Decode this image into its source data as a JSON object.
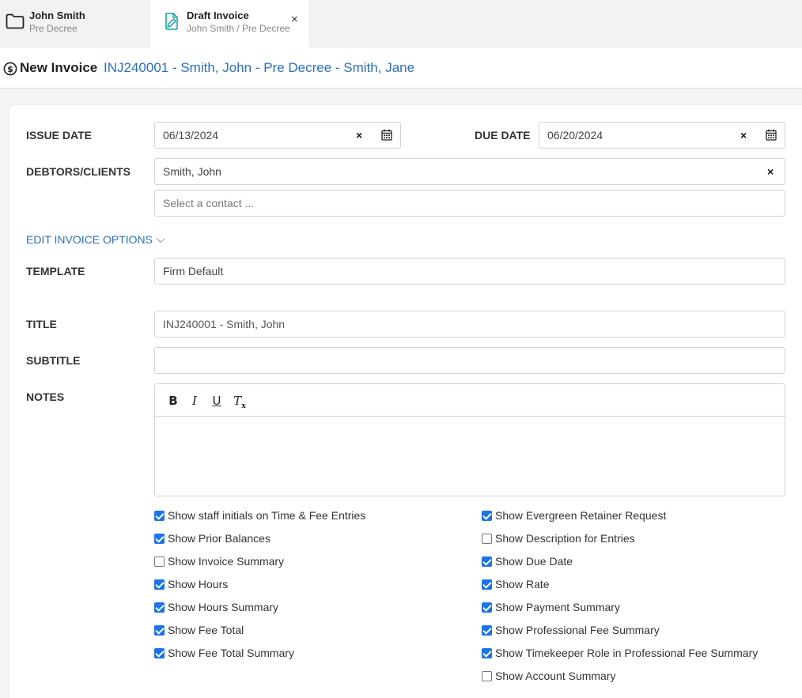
{
  "tabs": [
    {
      "title": "John Smith",
      "subtitle": "Pre Decree"
    },
    {
      "title": "Draft Invoice",
      "subtitle": "John Smith / Pre Decree",
      "close": "×"
    }
  ],
  "header": {
    "title": "New Invoice",
    "reference": "INJ240001 - Smith, John - Pre Decree - Smith, Jane"
  },
  "form": {
    "issue_date_label": "ISSUE DATE",
    "issue_date_value": "06/13/2024",
    "due_date_label": "DUE DATE",
    "due_date_value": "06/20/2024",
    "debtors_label": "DEBTORS/CLIENTS",
    "debtor_value": "Smith, John",
    "contact_placeholder": "Select a contact ...",
    "edit_options_label": "EDIT INVOICE OPTIONS",
    "template_label": "TEMPLATE",
    "template_value": "Firm Default",
    "title_label": "TITLE",
    "title_value": "INJ240001 - Smith, John",
    "subtitle_label": "SUBTITLE",
    "subtitle_value": "",
    "notes_label": "NOTES",
    "clear_symbol": "×"
  },
  "options_left": [
    {
      "label": "Show staff initials on Time & Fee Entries",
      "checked": true
    },
    {
      "label": "Show Prior Balances",
      "checked": true
    },
    {
      "label": "Show Invoice Summary",
      "checked": false
    },
    {
      "label": "Show Hours",
      "checked": true
    },
    {
      "label": "Show Hours Summary",
      "checked": true
    },
    {
      "label": "Show Fee Total",
      "checked": true
    },
    {
      "label": "Show Fee Total Summary",
      "checked": true
    }
  ],
  "options_right": [
    {
      "label": "Show Evergreen Retainer Request",
      "checked": true
    },
    {
      "label": "Show Description for Entries",
      "checked": false
    },
    {
      "label": "Show Due Date",
      "checked": true
    },
    {
      "label": "Show Rate",
      "checked": true
    },
    {
      "label": "Show Payment Summary",
      "checked": true
    },
    {
      "label": "Show Professional Fee Summary",
      "checked": true
    },
    {
      "label": "Show Timekeeper Role in Professional Fee Summary",
      "checked": true
    },
    {
      "label": "Show Account Summary",
      "checked": false
    }
  ],
  "colors": {
    "accent": "#1a73e8",
    "link": "#2a6ec6",
    "border": "#cfd3d8"
  },
  "icons": [
    "folder-icon",
    "file-edit-icon",
    "close-icon",
    "dollar-circle-icon",
    "calendar-icon",
    "clear-x-icon",
    "chevron-down-icon",
    "bold-icon",
    "italic-icon",
    "underline-icon",
    "clear-format-icon"
  ]
}
